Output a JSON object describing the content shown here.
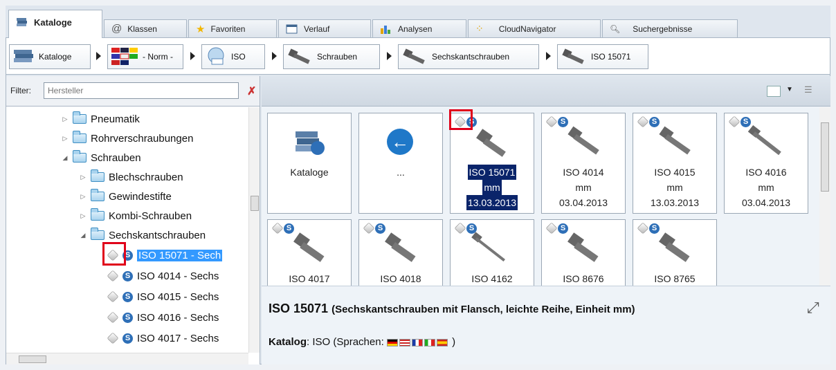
{
  "tabs": [
    {
      "label": "Kataloge",
      "icon": "catalogs-icon"
    },
    {
      "label": "Klassen",
      "icon": "at-icon"
    },
    {
      "label": "Favoriten",
      "icon": "star-icon"
    },
    {
      "label": "Verlauf",
      "icon": "calendar-icon"
    },
    {
      "label": "Analysen",
      "icon": "bar-chart-icon"
    },
    {
      "label": "CloudNavigator",
      "icon": "cloud-network-icon"
    },
    {
      "label": "Suchergebnisse",
      "icon": "search-icon"
    }
  ],
  "breadcrumb": [
    {
      "label": "Kataloge",
      "icon": "catalogs-icon"
    },
    {
      "label": "- Norm -",
      "icon": "flags-icon"
    },
    {
      "label": "ISO",
      "icon": "iso-globe-icon"
    },
    {
      "label": "Schrauben",
      "icon": "screw-icon"
    },
    {
      "label": "Sechskantschrauben",
      "icon": "screw-icon"
    },
    {
      "label": "ISO 15071",
      "icon": "screw-icon"
    }
  ],
  "filter": {
    "label": "Filter:",
    "placeholder": "Hersteller"
  },
  "tree": {
    "folders": [
      "Pneumatik",
      "Rohrverschraubungen",
      "Schrauben",
      "Blechschrauben",
      "Gewindestifte",
      "Kombi-Schrauben",
      "Sechskantschrauben"
    ],
    "parts": [
      "ISO 15071 - Sech",
      "ISO 4014 - Sechs",
      "ISO 4015 - Sechs",
      "ISO 4016 - Sechs",
      "ISO 4017 - Sechs"
    ],
    "badge": "S"
  },
  "tiles": [
    {
      "lines": [
        "Kataloge"
      ]
    },
    {
      "lines": [
        "..."
      ]
    },
    {
      "lines": [
        "ISO 15071",
        "mm",
        "13.03.2013"
      ]
    },
    {
      "lines": [
        "ISO 4014",
        "mm",
        "03.04.2013"
      ]
    },
    {
      "lines": [
        "ISO 4015",
        "mm",
        "13.03.2013"
      ]
    },
    {
      "lines": [
        "ISO 4016",
        "mm",
        "03.04.2013"
      ]
    },
    {
      "lines": [
        "ISO 4017"
      ]
    },
    {
      "lines": [
        "ISO 4018"
      ]
    },
    {
      "lines": [
        "ISO 4162"
      ]
    },
    {
      "lines": [
        "ISO 8676"
      ]
    },
    {
      "lines": [
        "ISO 8765"
      ]
    }
  ],
  "detail": {
    "title": "ISO 15071",
    "subtitle": "(Sechskantschrauben mit Flansch, leichte Reihe, Einheit mm)",
    "catalog_label": "Katalog",
    "catalog_value": ": ISO (Sprachen: ",
    "catalog_close": " )"
  },
  "colors": {
    "accent": "#2e6fb7",
    "selection": "#3399ff",
    "highlight": "#0a246a",
    "marker": "#e0001a"
  }
}
